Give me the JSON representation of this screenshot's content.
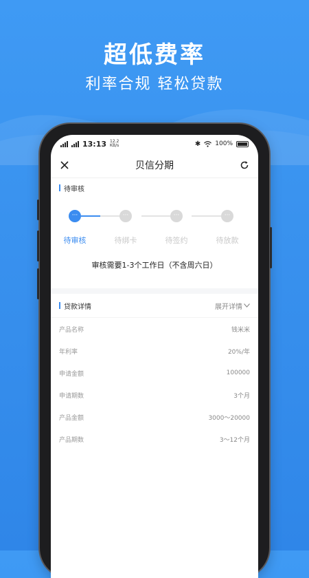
{
  "hero": {
    "title": "超低费率",
    "subtitle": "利率合规 轻松贷款"
  },
  "status_bar": {
    "time": "13:13",
    "net_speed": "12.2",
    "net_unit": "KB/s",
    "battery": "100%"
  },
  "nav": {
    "title": "贝信分期",
    "close_icon": "close-icon",
    "refresh_icon": "refresh-icon"
  },
  "review_section": {
    "title": "待审核"
  },
  "steps": [
    {
      "label": "待审核",
      "active": true
    },
    {
      "label": "待绑卡",
      "active": false
    },
    {
      "label": "待签约",
      "active": false
    },
    {
      "label": "待放款",
      "active": false
    }
  ],
  "review_note": "审核需要1-3个工作日（不含周六日）",
  "details": {
    "title": "贷款详情",
    "expand_label": "展开详情",
    "rows": [
      {
        "label": "产品名称",
        "value": "钱米米"
      },
      {
        "label": "年利率",
        "value": "20%/年"
      },
      {
        "label": "申请金额",
        "value": "100000"
      },
      {
        "label": "申请期数",
        "value": "3个月"
      },
      {
        "label": "产品金额",
        "value": "3000～20000"
      },
      {
        "label": "产品期数",
        "value": "3～12个月"
      }
    ]
  },
  "colors": {
    "accent": "#3b8cf0",
    "background": "#3a93ef"
  }
}
